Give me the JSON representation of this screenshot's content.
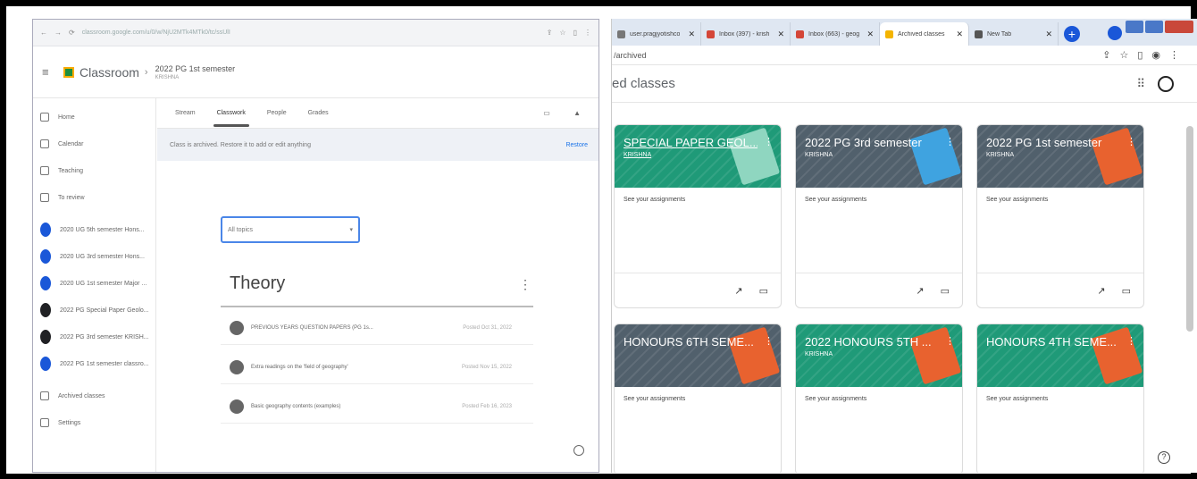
{
  "left": {
    "address_url": "classroom.google.com/u/0/w/NjU2MTk4MTk0/tc/ssUlI",
    "brand": "Classroom",
    "course_title": "2022 PG 1st semester",
    "course_sub": "KRISHNA",
    "sidebar": [
      {
        "label": "Home",
        "type": "icon"
      },
      {
        "label": "Calendar",
        "type": "icon"
      },
      {
        "label": "Teaching",
        "type": "icon"
      },
      {
        "label": "To review",
        "type": "icon"
      },
      {
        "label": "2020 UG 5th semester Hons...",
        "type": "blue"
      },
      {
        "label": "2020 UG 3rd semester Hons...",
        "type": "blue"
      },
      {
        "label": "2020 UG 1st semester Major ...",
        "type": "blue"
      },
      {
        "label": "2022 PG Special Paper Geolo...",
        "type": "black"
      },
      {
        "label": "2022 PG 3rd semester KRISH...",
        "type": "black"
      },
      {
        "label": "2022 PG 1st semester classro...",
        "type": "blue"
      },
      {
        "label": "Archived classes",
        "type": "icon"
      },
      {
        "label": "Settings",
        "type": "icon"
      }
    ],
    "tabs": [
      "Stream",
      "Classwork",
      "People",
      "Grades"
    ],
    "active_tab": "Classwork",
    "banner_text": "Class is archived. Restore it to add or edit anything",
    "restore_label": "Restore",
    "topic_select": "All topics",
    "topic_title": "Theory",
    "materials": [
      {
        "title": "PREVIOUS YEARS QUESTION PAPERS (PG 1s...",
        "date": "Posted Oct 31, 2022"
      },
      {
        "title": "Extra readings on the 'field of geography'",
        "date": "Posted Nov 15, 2022"
      },
      {
        "title": "Basic geography contents (examples)",
        "date": "Posted Feb 16, 2023"
      }
    ]
  },
  "right": {
    "tabs": [
      {
        "title": "user.pragjyotishco",
        "color": "#777777"
      },
      {
        "title": "Inbox (397) - krish",
        "color": "#d44638"
      },
      {
        "title": "Inbox (663) - geog",
        "color": "#d44638"
      },
      {
        "title": "Archived classes",
        "color": "#f4b400",
        "active": true
      },
      {
        "title": "New Tab",
        "color": "#555555"
      }
    ],
    "address_text": "/archived",
    "page_title": "ed classes",
    "cards": [
      {
        "title": "SPECIAL PAPER GEOL...",
        "sub": "KRISHNA",
        "link": "See your assignments",
        "theme": "green",
        "art": "#8fd6c0",
        "underline": true
      },
      {
        "title": "2022 PG 3rd semester",
        "sub": "KRISHNA",
        "link": "See your assignments",
        "theme": "gray",
        "art": "#3fa3e0"
      },
      {
        "title": "2022 PG 1st semester",
        "sub": "KRISHNA",
        "link": "See your assignments",
        "theme": "gray",
        "art": "#e8622f"
      },
      {
        "title": "HONOURS 6TH SEME...",
        "sub": "",
        "link": "See your assignments",
        "theme": "gray",
        "art": "#e8622f"
      },
      {
        "title": "2022 HONOURS 5TH ...",
        "sub": "KRISHNA",
        "link": "See your assignments",
        "theme": "green",
        "art": "#e8622f"
      },
      {
        "title": "HONOURS 4TH SEME...",
        "sub": "",
        "link": "See your assignments",
        "theme": "green",
        "art": "#e8622f"
      }
    ]
  }
}
